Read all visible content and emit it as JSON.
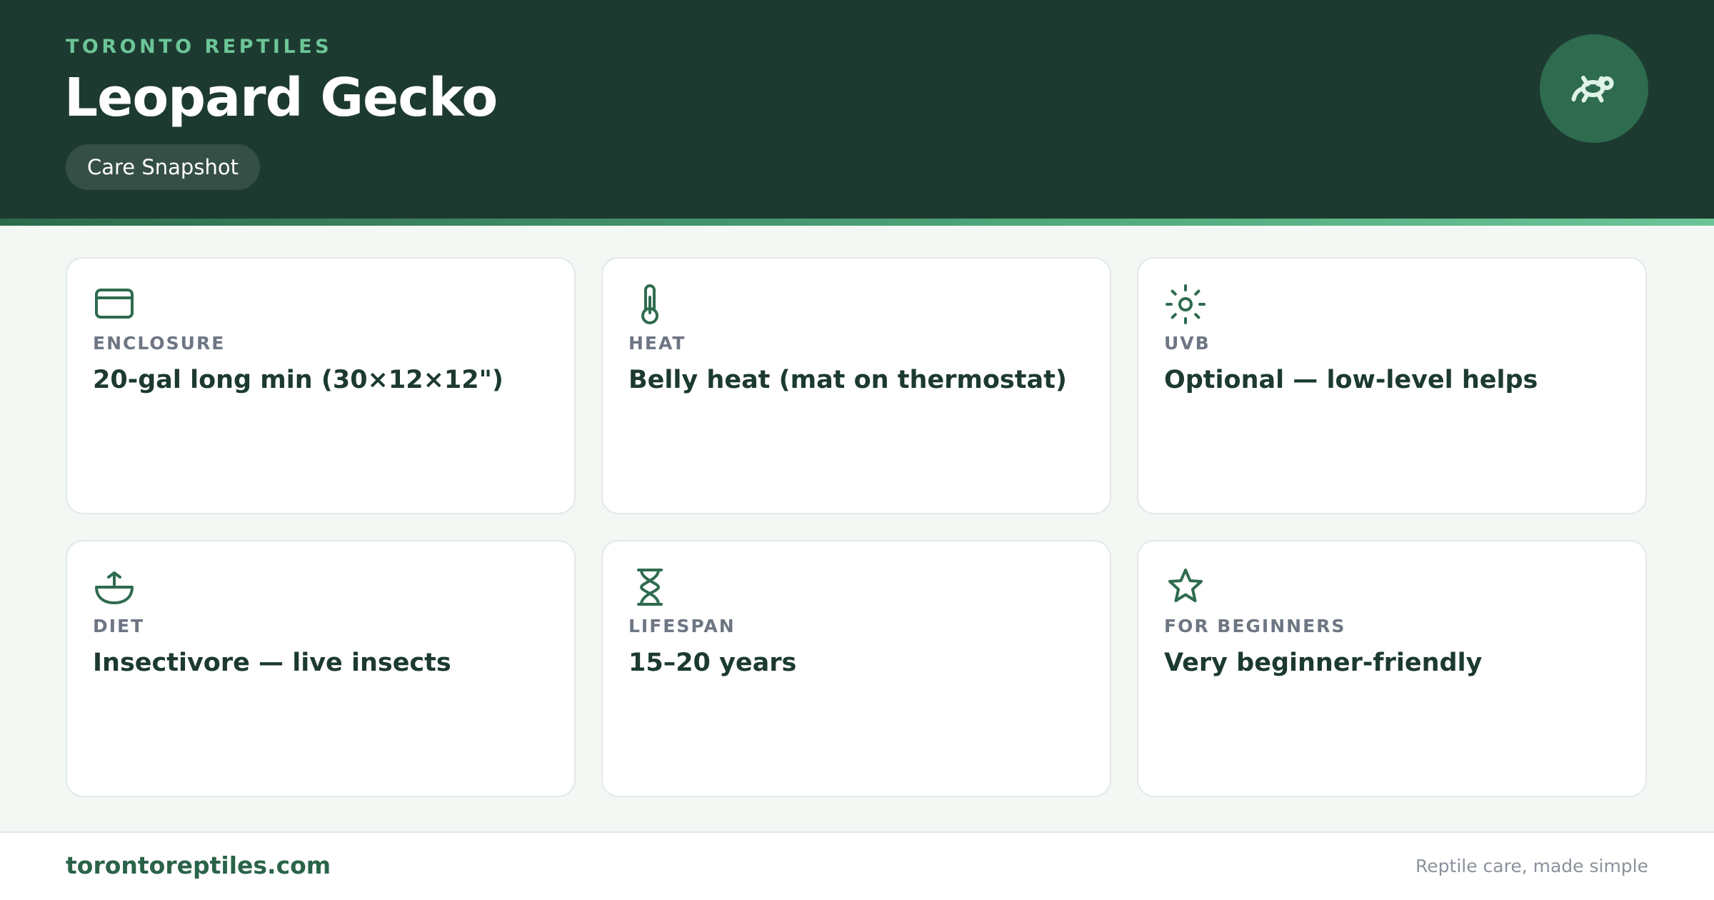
{
  "header": {
    "brand": "TORONTO REPTILES",
    "title": "Leopard Gecko",
    "badge": "Care Snapshot",
    "logo_icon": "gecko-icon"
  },
  "colors": {
    "header_bg": "#1d3a30",
    "accent": "#6cc597",
    "icon": "#2e6b4f",
    "page_bg": "#f3f8f5"
  },
  "cards": [
    {
      "icon": "enclosure-icon",
      "label": "ENCLOSURE",
      "value": "20-gal long min (30×12×12\")"
    },
    {
      "icon": "thermometer-icon",
      "label": "HEAT",
      "value": "Belly heat (mat on thermostat)"
    },
    {
      "icon": "sun-icon",
      "label": "UVB",
      "value": "Optional — low-level helps"
    },
    {
      "icon": "bowl-icon",
      "label": "DIET",
      "value": "Insectivore — live insects"
    },
    {
      "icon": "hourglass-icon",
      "label": "LIFESPAN",
      "value": "15–20 years"
    },
    {
      "icon": "star-icon",
      "label": "FOR BEGINNERS",
      "value": "Very beginner-friendly"
    }
  ],
  "footer": {
    "site": "torontoreptiles.com",
    "tagline": "Reptile care, made simple"
  }
}
